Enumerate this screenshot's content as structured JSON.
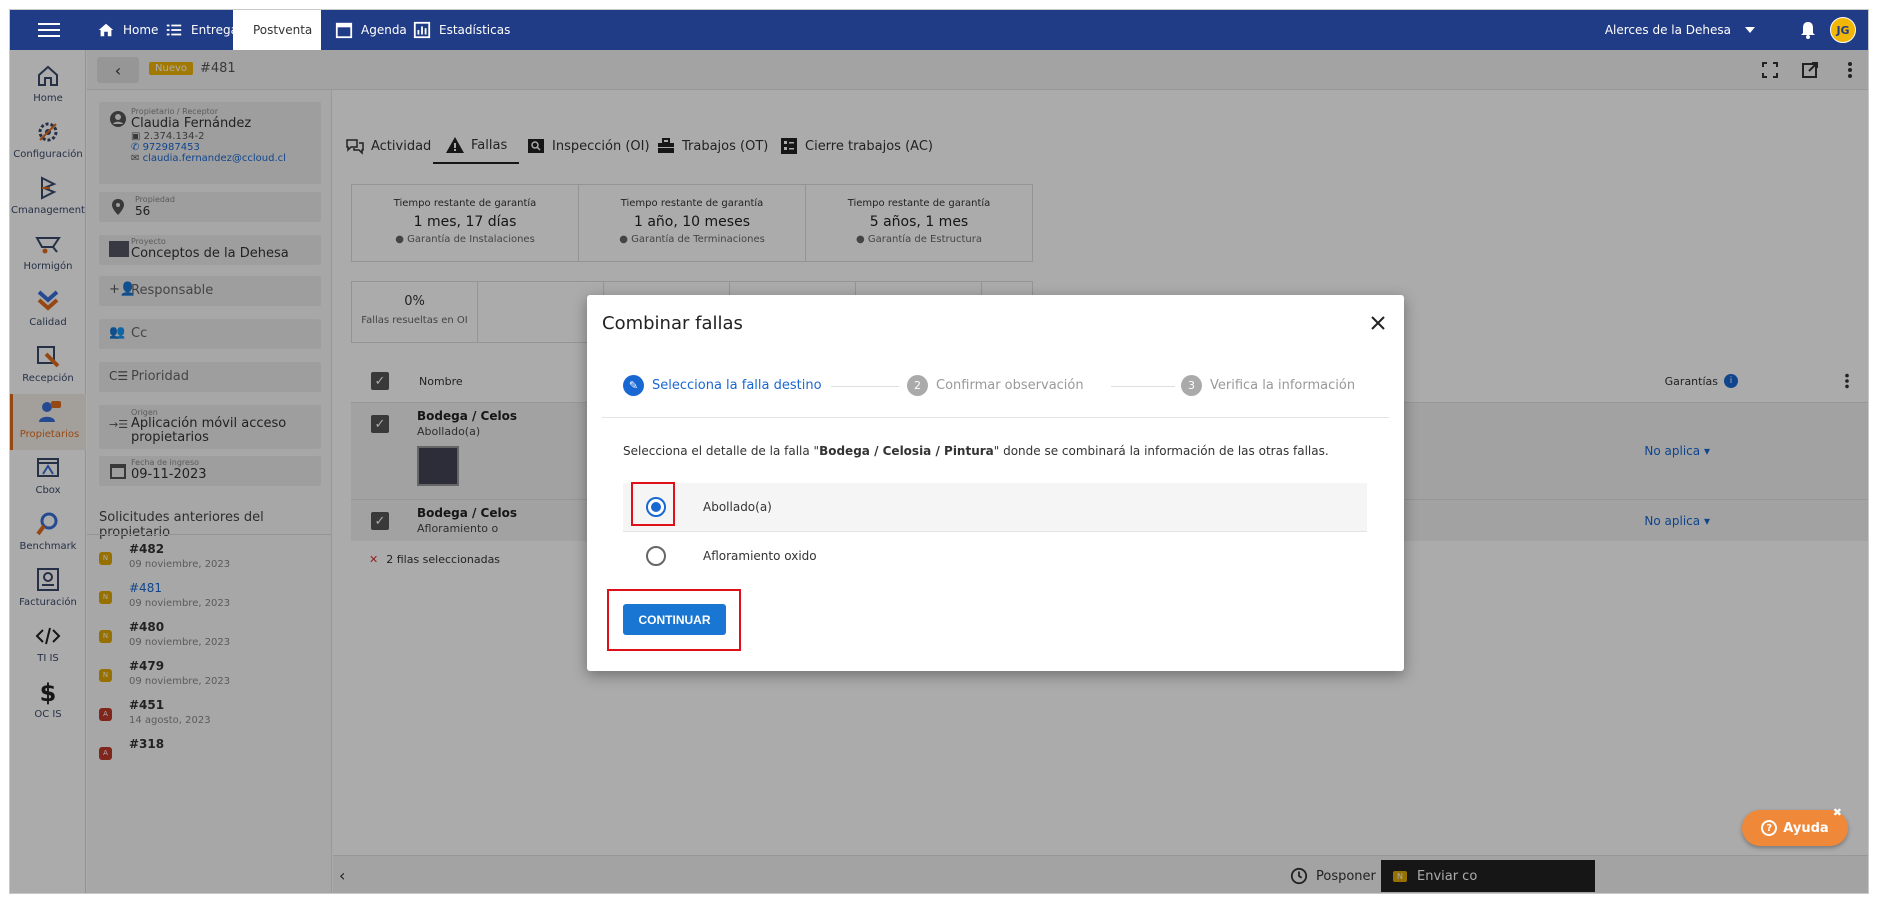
{
  "topbar": {
    "tabs": [
      {
        "label": "Home",
        "icon": "home-icon"
      },
      {
        "label": "Entregas",
        "icon": "list-icon"
      },
      {
        "label": "Postventa",
        "icon": "clipboard-icon"
      },
      {
        "label": "Agenda",
        "icon": "calendar-icon"
      },
      {
        "label": "Estadísticas",
        "icon": "chart-icon"
      }
    ],
    "active_tab": "Postventa",
    "org_name": "Alerces de la Dehesa",
    "avatar_initials": "JG"
  },
  "leftnav": {
    "items": [
      {
        "label": "Home"
      },
      {
        "label": "Configuración"
      },
      {
        "label": "Cmanagement"
      },
      {
        "label": "Hormigón"
      },
      {
        "label": "Calidad"
      },
      {
        "label": "Recepción"
      },
      {
        "label": "Propietarios"
      },
      {
        "label": "Cbox"
      },
      {
        "label": "Benchmark"
      },
      {
        "label": "Facturación"
      },
      {
        "label": "TI IS"
      },
      {
        "label": "OC IS"
      }
    ],
    "active": "Propietarios"
  },
  "subbar": {
    "status_badge": "Nuevo",
    "ticket_id": "#481"
  },
  "leftpanel": {
    "owner_label": "Propietario / Receptor",
    "owner_name": "Claudia Fernández",
    "owner_rut": "2.374.134-2",
    "owner_phone": "972987453",
    "owner_email": "claudia.fernandez@ccloud.cl",
    "property_label": "Propiedad",
    "property_value": "56",
    "project_label": "Proyecto",
    "project_value": "Conceptos de la Dehesa",
    "responsable": "Responsable",
    "cc": "Cc",
    "prioridad": "Prioridad",
    "origin_label": "Origen",
    "origin_value": "Aplicación móvil acceso propietarios",
    "date_label": "Fecha de ingreso",
    "date_value": "09-11-2023",
    "previous_title": "Solicitudes anteriores del propietario",
    "previous": [
      {
        "id": "#482",
        "date": "09 noviembre, 2023",
        "tag": "N",
        "color": "#e0a800"
      },
      {
        "id": "#481",
        "date": "09 noviembre, 2023",
        "tag": "N",
        "color": "#e0a800"
      },
      {
        "id": "#480",
        "date": "09 noviembre, 2023",
        "tag": "N",
        "color": "#e0a800"
      },
      {
        "id": "#479",
        "date": "09 noviembre, 2023",
        "tag": "N",
        "color": "#e0a800"
      },
      {
        "id": "#451",
        "date": "14 agosto, 2023",
        "tag": "A",
        "color": "#c0392b"
      },
      {
        "id": "#318",
        "date": "",
        "tag": "A",
        "color": "#c0392b"
      }
    ]
  },
  "main": {
    "tabs": [
      {
        "label": "Actividad"
      },
      {
        "label": "Fallas"
      },
      {
        "label": "Inspección (OI)"
      },
      {
        "label": "Trabajos (OT)"
      },
      {
        "label": "Cierre trabajos (AC)"
      }
    ],
    "active_tab": "Fallas",
    "warranty": [
      {
        "title": "Tiempo restante de garantía",
        "value": "1 mes, 17 días",
        "note": "Garantía de Instalaciones"
      },
      {
        "title": "Tiempo restante de garantía",
        "value": "1 año, 10 meses",
        "note": "Garantía de Terminaciones"
      },
      {
        "title": "Tiempo restante de garantía",
        "value": "5 años, 1 mes",
        "note": "Garantía de Estructura"
      }
    ],
    "stats": [
      {
        "value": "0%",
        "label": "Fallas resueltas en OI"
      }
    ],
    "table": {
      "col_name": "Nombre",
      "col_garantias": "Garantías",
      "rows": [
        {
          "name": "Bodega / Celos",
          "detail": "Abollado(a)",
          "warranty": "No aplica"
        },
        {
          "name": "Bodega / Celos",
          "detail": "Afloramiento o",
          "warranty": "No aplica"
        }
      ],
      "selection_info": "2 filas seleccionadas"
    },
    "footer": {
      "posponer": "Posponer",
      "enviar": "Enviar co",
      "enviar_tag": "N"
    },
    "help_label": "Ayuda"
  },
  "dialog": {
    "title": "Combinar fallas",
    "steps": [
      {
        "n": "",
        "label": "Selecciona la falla destino"
      },
      {
        "n": "2",
        "label": "Confirmar observación"
      },
      {
        "n": "3",
        "label": "Verifica la información"
      }
    ],
    "desc_prefix": "Selecciona el detalle de la falla \"",
    "desc_bold": "Bodega / Celosia / Pintura",
    "desc_suffix": "\" donde se combinará la información de las otras fallas.",
    "options": [
      {
        "label": "Abollado(a)",
        "selected": true
      },
      {
        "label": "Afloramiento oxido",
        "selected": false
      }
    ],
    "continue_label": "CONTINUAR"
  },
  "colors": {
    "topbar": "#213c86",
    "accent": "#1976d2",
    "active_nav": "#e06c1d",
    "highlight_box": "#e0101a"
  }
}
